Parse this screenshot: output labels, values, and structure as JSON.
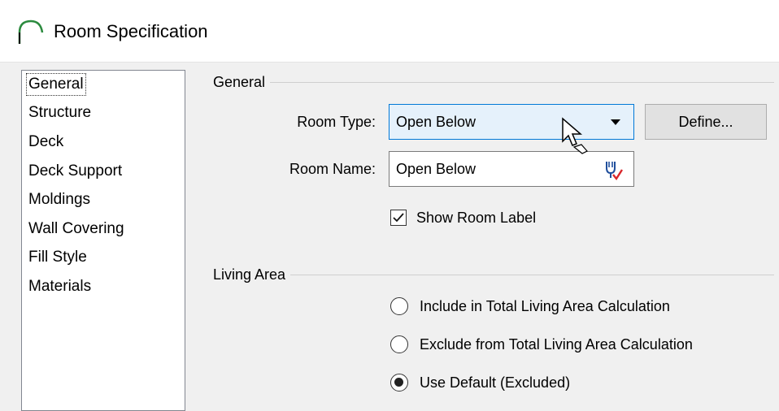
{
  "window": {
    "title": "Room Specification",
    "icon": "arc-room-icon"
  },
  "nav": {
    "items": [
      {
        "label": "General",
        "selected": true
      },
      {
        "label": "Structure",
        "selected": false
      },
      {
        "label": "Deck",
        "selected": false
      },
      {
        "label": "Deck Support",
        "selected": false
      },
      {
        "label": "Moldings",
        "selected": false
      },
      {
        "label": "Wall Covering",
        "selected": false
      },
      {
        "label": "Fill Style",
        "selected": false
      },
      {
        "label": "Materials",
        "selected": false
      }
    ]
  },
  "general": {
    "group_label": "General",
    "room_type": {
      "label": "Room Type:",
      "value": "Open Below"
    },
    "define_button": "Define...",
    "room_name": {
      "label": "Room Name:",
      "value": "Open Below",
      "icon": "library-lookup-icon"
    },
    "show_room_label": {
      "label": "Show Room Label",
      "checked": true
    }
  },
  "living_area": {
    "group_label": "Living Area",
    "options": [
      {
        "label": "Include in Total Living Area Calculation",
        "selected": false
      },
      {
        "label": "Exclude from Total Living Area Calculation",
        "selected": false
      },
      {
        "label": "Use Default (Excluded)",
        "selected": true
      }
    ]
  },
  "colors": {
    "accent": "#0078d7",
    "combo_hover": "#e5f1fb",
    "check_red": "#d9262b"
  }
}
